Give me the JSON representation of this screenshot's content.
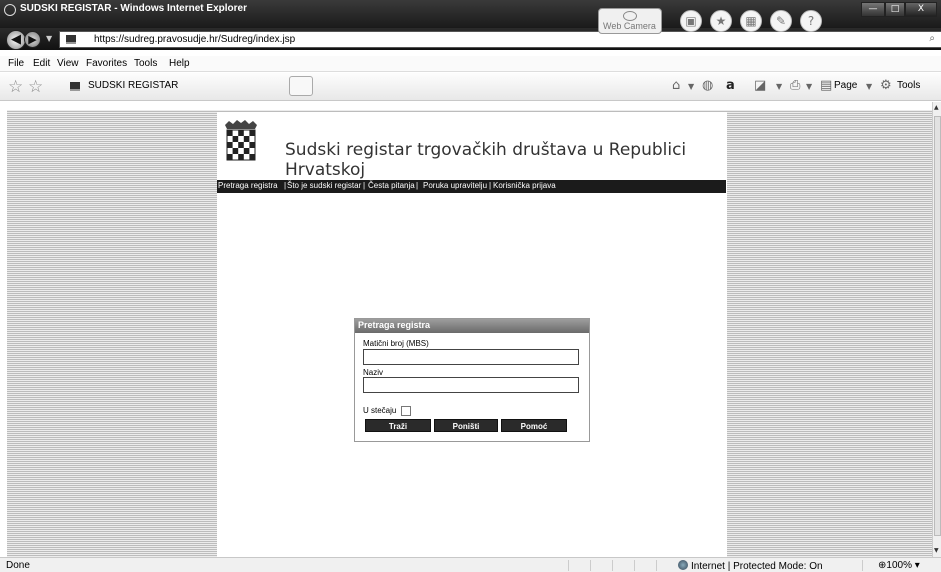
{
  "window": {
    "title": "SUDSKI REGISTAR - Windows Internet Explorer",
    "controls": {
      "minimize": "—",
      "maximize": "□",
      "close": "X"
    }
  },
  "hardware": {
    "webcam_label": "Web Camera",
    "help_glyph": "?"
  },
  "address": {
    "url": "https://sudreg.pravosudje.hr/Sudreg/index.jsp"
  },
  "menu": [
    "File",
    "Edit",
    "View",
    "Favorites",
    "Tools",
    "Help"
  ],
  "tab": {
    "label": "SUDSKI REGISTAR"
  },
  "commands": {
    "page": "Page",
    "tools": "Tools"
  },
  "site": {
    "title": "Sudski registar trgovačkih društava u Republici Hrvatskoj",
    "nav": [
      "Pretraga registra",
      "Što je sudski registar",
      "Česta pitanja",
      "Poruka upravitelju",
      "Korisnička prijava"
    ]
  },
  "form": {
    "title": "Pretraga registra",
    "mbs_label": "Matični broj (MBS)",
    "mbs_value": "",
    "naziv_label": "Naziv",
    "naziv_value": "",
    "stecaj_label": "U stečaju",
    "buttons": {
      "search": "Traži",
      "reset": "Poništi",
      "help": "Pomoć"
    }
  },
  "status": {
    "left": "Done",
    "zone": "Internet | Protected Mode: On",
    "zoom": "100%"
  }
}
